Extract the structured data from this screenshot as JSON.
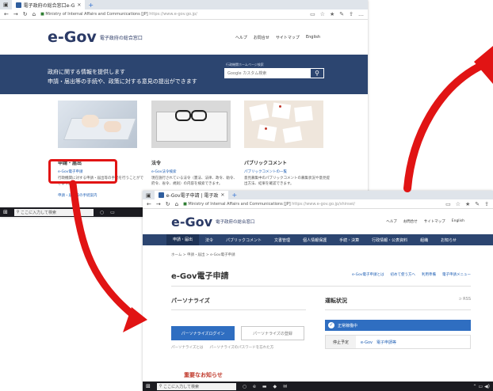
{
  "win1": {
    "tab": {
      "title": "電子政府の総合窓口e-G"
    },
    "address": {
      "site": "Ministry of Internal Affairs and Communications [JP]",
      "url": "https://www.e-gov.go.jp/"
    },
    "header": {
      "logo": "e-Gov",
      "logo_subtitle": "電子政府の総合窓口",
      "links": [
        "ヘルプ",
        "お問合せ",
        "サイトマップ",
        "English"
      ]
    },
    "hero": {
      "line1": "政府に関する情報を提供します",
      "line2": "申請・届出等の手続や、政策に対する意見の提出ができます",
      "search_label": "行政機関ホームページ検索",
      "search_placeholder": "Google カスタム検索"
    },
    "cards": [
      {
        "title": "申請・届出",
        "link": "e-Gov電子申請",
        "desc": "行政機関に対する申請・届出等の手続を行うことができます。",
        "more": "申請・届出等の手続案内"
      },
      {
        "title": "法令",
        "link": "e-Gov法令検索",
        "desc": "現在施行されている法令（憲法、法律、政令、勅令、府令、省令、規則）の内容を検索できます。",
        "more": ""
      },
      {
        "title": "パブリックコメント",
        "link": "パブリックコメントの一覧",
        "desc": "意見募集中のパブリックコメントの募集状況や意見提出方法、結果を確認できます。",
        "more": ""
      }
    ],
    "taskbar": {
      "search": "ここに入力して検索"
    }
  },
  "win2": {
    "tab": {
      "title": "e-Gov電子申請 | 電子政"
    },
    "address": {
      "site": "Ministry of Internal Affairs and Communications [JP]",
      "url": "https://www.e-gov.go.jp/shinsei/"
    },
    "header": {
      "logo": "e-Gov",
      "logo_subtitle": "電子政府の総合窓口",
      "links": [
        "ヘルプ",
        "お問合せ",
        "サイトマップ",
        "English"
      ]
    },
    "nav": [
      "申請・届出",
      "法令",
      "パブリックコメント",
      "文書管理",
      "個人情報保護",
      "手続・決算",
      "行政情報・公表資料",
      "組織",
      "お知らせ"
    ],
    "breadcrumb": "ホーム > 申請・届出 > e-Gov電子申請",
    "page_title": "e-Gov電子申請",
    "title_links": [
      "e-Gov電子申請とは",
      "初めて使う方へ",
      "利用準備",
      "電子申請メニュー"
    ],
    "personalize": {
      "title": "パーソナライズ",
      "login_button": "パーソナライズログイン",
      "register_button": "パーソナライズの登録",
      "link1": "パーソナライズとは",
      "link2": "パーソナライズのパスワードを忘れた方"
    },
    "status": {
      "title": "運転状況",
      "rss": "RSS",
      "banner": "正常稼働中",
      "row_label": "停止予定",
      "row_value": "e-Gov　電子申請等"
    },
    "notice_title": "重要なお知らせ",
    "taskbar": {
      "search": "ここに入力して検索"
    }
  },
  "colors": {
    "navy": "#2c4570",
    "accent_blue": "#2f6ec1",
    "highlight_red": "#e11414"
  }
}
